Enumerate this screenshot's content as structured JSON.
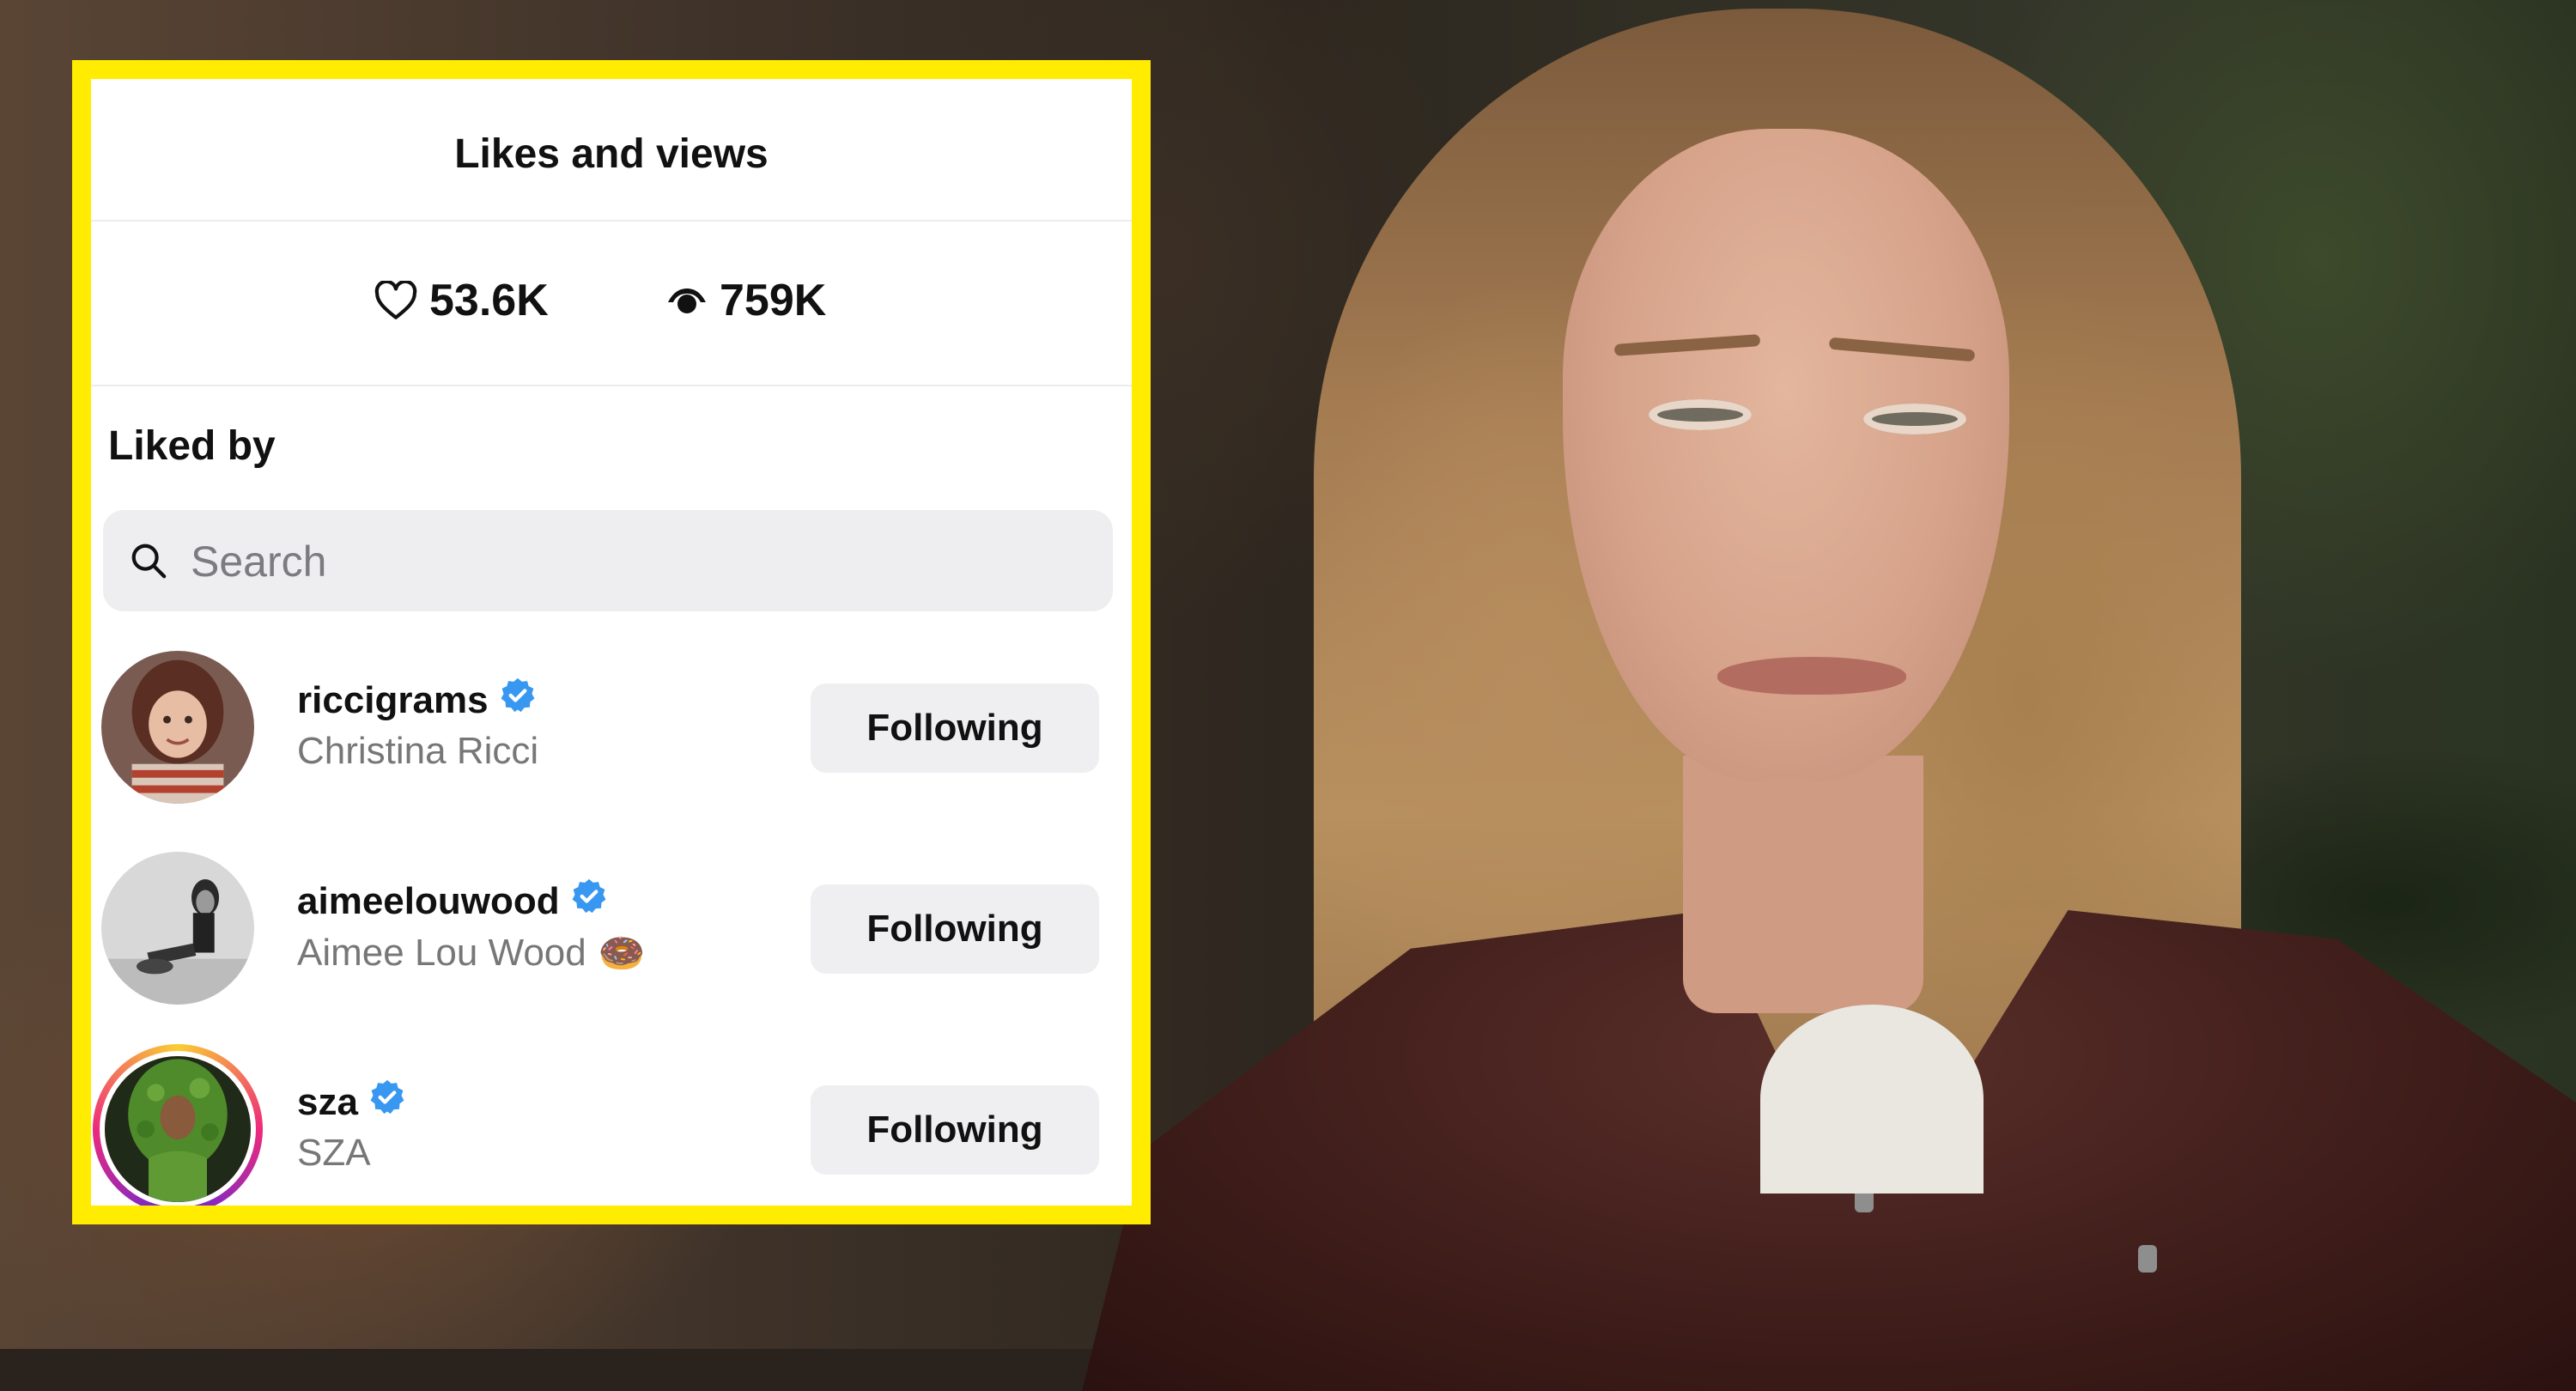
{
  "panel": {
    "title": "Likes and views",
    "stats": {
      "likes": "53.6K",
      "views": "759K"
    },
    "section_title": "Liked by",
    "search": {
      "placeholder": "Search",
      "value": ""
    },
    "users": [
      {
        "username": "riccigrams",
        "full_name": "Christina Ricci",
        "emoji": "",
        "button": "Following",
        "story_ring": false
      },
      {
        "username": "aimeelouwood",
        "full_name": "Aimee Lou Wood",
        "emoji": "🍩",
        "button": "Following",
        "story_ring": false
      },
      {
        "username": "sza",
        "full_name": "SZA",
        "emoji": "",
        "button": "Following",
        "story_ring": true
      }
    ]
  },
  "colors": {
    "frame": "#ffec00",
    "verified": "#3897f0",
    "button_bg": "#efeff1",
    "secondary_text": "#777777"
  },
  "icons": [
    "heart-icon",
    "eye-icon",
    "search-icon",
    "verified-badge-icon",
    "donut-emoji-icon"
  ]
}
